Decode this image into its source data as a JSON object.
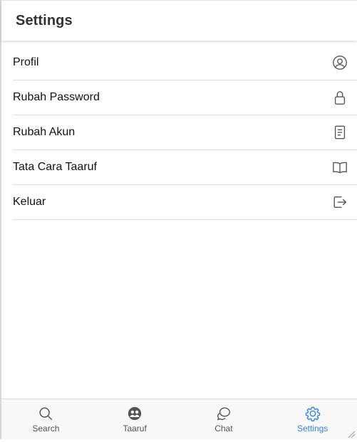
{
  "header": {
    "title": "Settings"
  },
  "menu": {
    "items": [
      {
        "label": "Profil",
        "icon": "user-circle-icon"
      },
      {
        "label": "Rubah Password",
        "icon": "lock-icon"
      },
      {
        "label": "Rubah Akun",
        "icon": "document-icon"
      },
      {
        "label": "Tata Cara Taaruf",
        "icon": "book-icon"
      },
      {
        "label": "Keluar",
        "icon": "logout-icon"
      }
    ]
  },
  "tabbar": {
    "tabs": [
      {
        "label": "Search",
        "icon": "search-icon",
        "active": false
      },
      {
        "label": "Taaruf",
        "icon": "people-icon",
        "active": false
      },
      {
        "label": "Chat",
        "icon": "chat-icon",
        "active": false
      },
      {
        "label": "Settings",
        "icon": "gear-icon",
        "active": true
      }
    ]
  },
  "colors": {
    "accent": "#3b82d6",
    "icon": "#555555",
    "divider": "#dcdcdc"
  }
}
